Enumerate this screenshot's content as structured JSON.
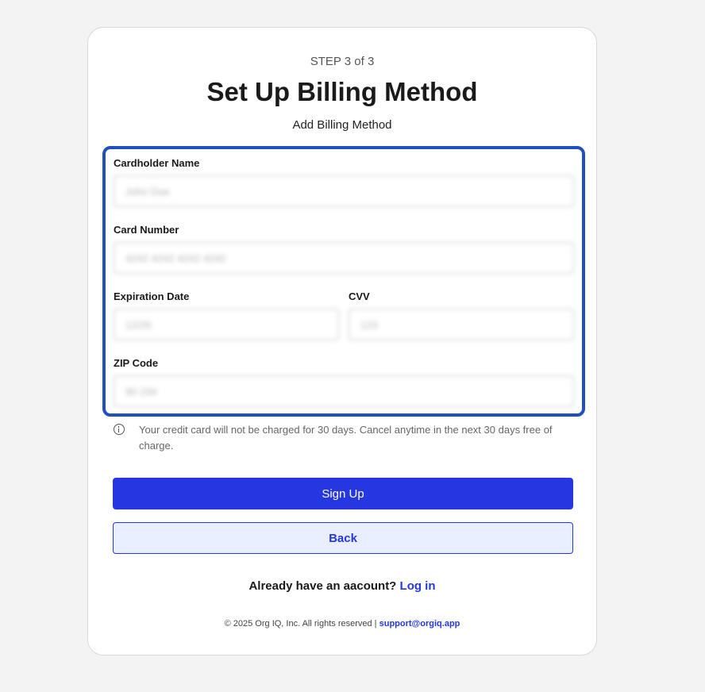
{
  "header": {
    "step": "STEP 3 of 3",
    "title": "Set Up Billing Method",
    "subtitle": "Add Billing Method"
  },
  "form": {
    "cardholder": {
      "label": "Cardholder Name",
      "placeholder": "John Doe"
    },
    "card_number": {
      "label": "Card Number",
      "placeholder": "4242 4242 4242 4242"
    },
    "expiration": {
      "label": "Expiration Date",
      "placeholder": "12/26"
    },
    "cvv": {
      "label": "CVV",
      "placeholder": "123"
    },
    "zip": {
      "label": "ZIP Code",
      "placeholder": "90 234"
    },
    "highlight_color": "#1f4fc1"
  },
  "notice": {
    "icon": "info-icon",
    "text": "Your credit card will not be charged for 30 days. Cancel anytime in the next 30 days free of charge."
  },
  "buttons": {
    "signup": "Sign Up",
    "back": "Back",
    "primary_color": "#2437e0"
  },
  "login": {
    "prompt": "Already have an aacount?",
    "link": "Log in"
  },
  "footer": {
    "copyright": "© 2025 Org IQ, Inc. All rights reserved |",
    "email": "support@orgiq.app"
  }
}
